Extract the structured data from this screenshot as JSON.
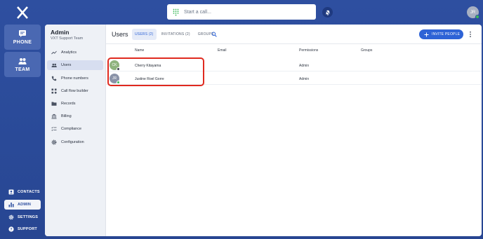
{
  "app": {
    "logo_icon": "x-logo-icon"
  },
  "rail": {
    "phone_label": "PHONE",
    "team_label": "TEAM",
    "links": [
      {
        "label": "CONTACTS",
        "icon": "contacts-icon"
      },
      {
        "label": "ADMIN",
        "icon": "chart-icon"
      },
      {
        "label": "SETTINGS",
        "icon": "gear-icon"
      },
      {
        "label": "SUPPORT",
        "icon": "help-icon"
      }
    ]
  },
  "callbar": {
    "placeholder": "Start a call..."
  },
  "user": {
    "initials": "JR"
  },
  "admin": {
    "title": "Admin",
    "team": "VXT Support Team",
    "nav": [
      {
        "label": "Analytics"
      },
      {
        "label": "Users"
      },
      {
        "label": "Phone numbers"
      },
      {
        "label": "Call flow builder"
      },
      {
        "label": "Records"
      },
      {
        "label": "Billing"
      },
      {
        "label": "Compliance"
      },
      {
        "label": "Configuration"
      }
    ]
  },
  "users_page": {
    "title": "Users",
    "tabs": [
      "USERS (2)",
      "INVITATIONS (2)",
      "GROUPS"
    ],
    "invite_label": "INVITE PEOPLE",
    "columns": [
      "Name",
      "Email",
      "Permissions",
      "Groups"
    ],
    "rows": [
      {
        "initials": "CK",
        "name": "Cherry Kitayama",
        "email": "",
        "permissions": "Admin",
        "groups": ""
      },
      {
        "initials": "JR",
        "name": "Justine Roel Gorre",
        "email": "",
        "permissions": "Admin",
        "groups": ""
      }
    ]
  },
  "colors": {
    "accent": "#2e63d6",
    "brand": "#2e4fa0",
    "highlight": "#e02a1f",
    "online": "#3cba5a"
  }
}
